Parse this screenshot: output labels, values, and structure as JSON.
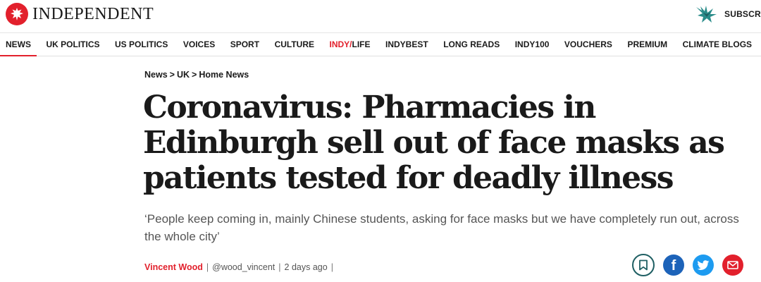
{
  "brand": {
    "name": "INDEPENDENT",
    "subscribe_label": "SUBSCRIBE"
  },
  "nav": {
    "items": [
      {
        "label": "NEWS",
        "active": true
      },
      {
        "label": "UK POLITICS"
      },
      {
        "label": "US POLITICS"
      },
      {
        "label": "VOICES"
      },
      {
        "label": "SPORT"
      },
      {
        "label": "CULTURE"
      },
      {
        "label_a": "INDY/",
        "label_b": "LIFE"
      },
      {
        "label": "INDYBEST"
      },
      {
        "label": "LONG READS"
      },
      {
        "label": "INDY100"
      },
      {
        "label": "VOUCHERS"
      },
      {
        "label": "PREMIUM"
      },
      {
        "label": "CLIMATE BLOGS"
      }
    ]
  },
  "breadcrumb": {
    "items": [
      "News",
      "UK",
      "Home News"
    ],
    "separator": ">"
  },
  "article": {
    "headline_lines": [
      "Coronavirus: Pharmacies in",
      "Edinburgh sell out of face masks as",
      "patients tested for deadly illness"
    ],
    "standfirst_lines": [
      "‘People keep coming in, mainly Chinese students, asking for face masks but we have completely run out, across",
      "the whole city’"
    ],
    "author": "Vincent Wood",
    "handle": "@wood_vincent",
    "posted": "2 days ago",
    "separator": "|"
  },
  "share": {
    "icons": [
      "bookmark-icon",
      "facebook-icon",
      "twitter-icon",
      "email-icon"
    ],
    "facebook_glyph": "f"
  },
  "colors": {
    "brand_red": "#e2202c",
    "facebook_blue": "#1d63b9",
    "twitter_blue": "#1d9bf0",
    "bookmark_teal": "#1f5f63",
    "standfirst_grey": "#555555"
  }
}
